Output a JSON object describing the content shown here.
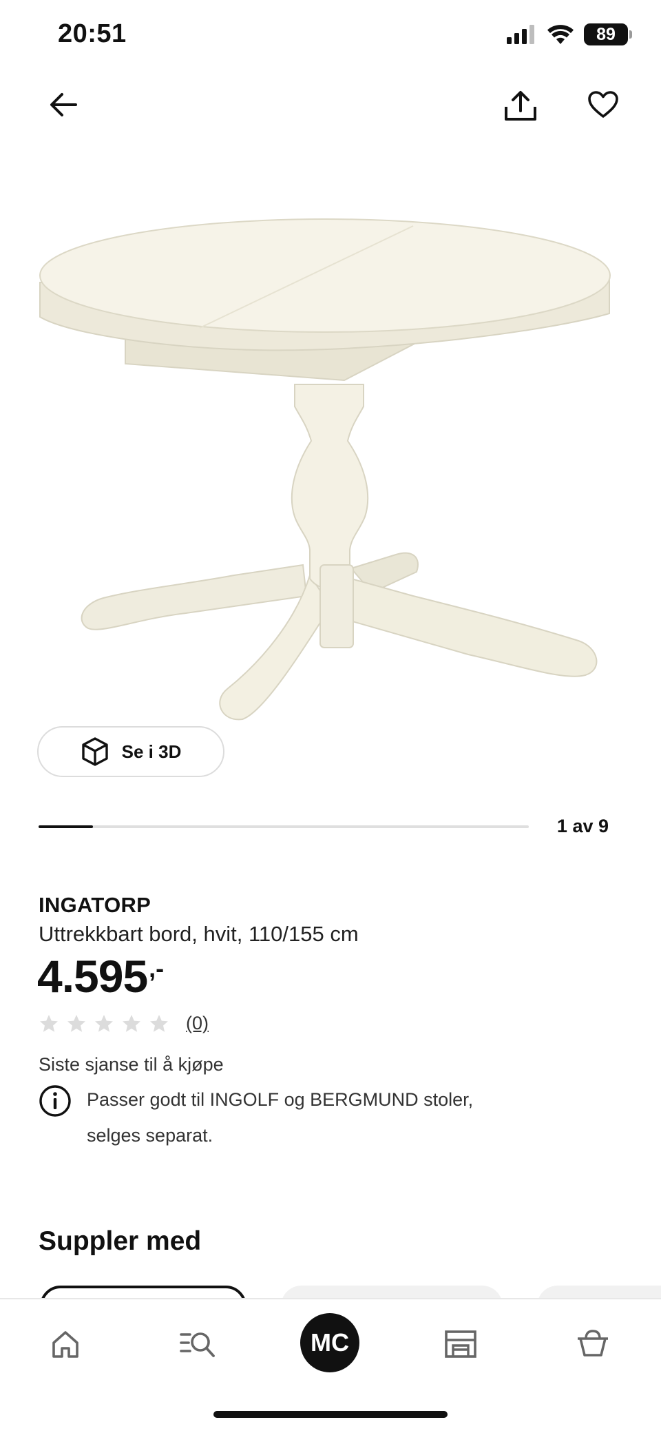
{
  "status_bar": {
    "time": "20:51",
    "battery": "89",
    "icons": [
      "cellular-signal-icon",
      "wifi-icon",
      "battery-icon"
    ]
  },
  "header": {
    "back_icon": "arrow-left-icon",
    "share_icon": "share-icon",
    "favorite_icon": "heart-outline-icon"
  },
  "gallery": {
    "view_3d_label": "Se i 3D",
    "view_3d_icon": "cube-icon",
    "page_indicator": "1 av 9",
    "current_page": 1,
    "total_pages": 9
  },
  "product": {
    "name": "INGATORP",
    "description": "Uttrekkbart bord, hvit, 110/155 cm",
    "price": "4.595",
    "price_suffix": ",-",
    "rating": {
      "stars_filled": 0,
      "stars_total": 5,
      "review_count": "(0)"
    },
    "availability": "Siste sjanse til å kjøpe",
    "info_note_line1": "Passer godt til INGOLF og BERGMUND stoler,",
    "info_note_line2": "selges separat."
  },
  "sections": {
    "complement_title": "Suppler med"
  },
  "bottom_nav": {
    "items": [
      {
        "icon": "home-icon"
      },
      {
        "icon": "search-list-icon"
      },
      {
        "avatar": "MC"
      },
      {
        "icon": "store-icon"
      },
      {
        "icon": "basket-icon"
      }
    ]
  },
  "colors": {
    "text": "#111111",
    "muted_text": "#333333",
    "star_empty": "#dcdcdc",
    "divider": "#e7e7e7",
    "table_color": "#f3f0e2"
  }
}
